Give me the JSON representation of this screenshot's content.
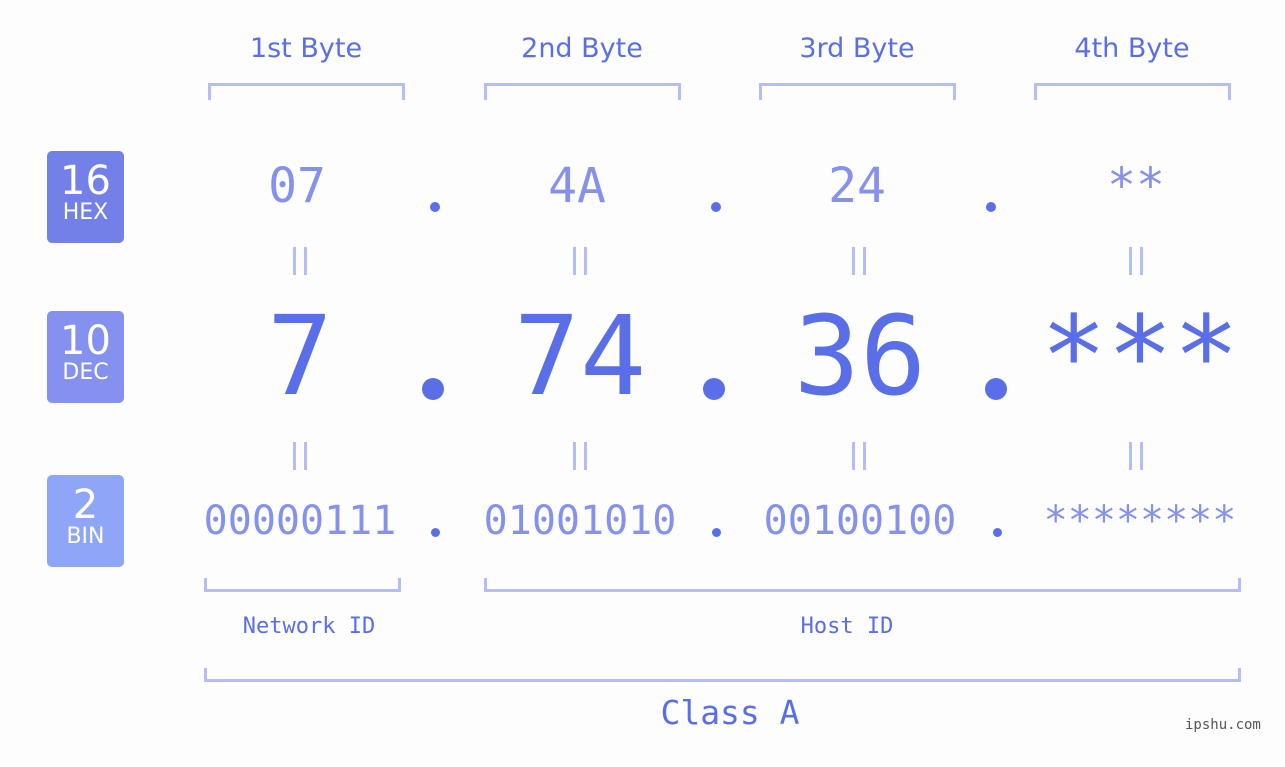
{
  "badges": [
    {
      "number": "16",
      "label": "HEX",
      "color": "#7280e8"
    },
    {
      "number": "10",
      "label": "DEC",
      "color": "#8591ee"
    },
    {
      "number": "2",
      "label": "BIN",
      "color": "#8fa6f8"
    }
  ],
  "byte_headers": [
    "1st Byte",
    "2nd Byte",
    "3rd Byte",
    "4th Byte"
  ],
  "hex": [
    "07",
    "4A",
    "24",
    "**"
  ],
  "dec": [
    "7",
    "74",
    "36",
    "***"
  ],
  "bin": [
    "00000111",
    "01001010",
    "00100100",
    "********"
  ],
  "separator": ".",
  "network_label": "Network ID",
  "host_label": "Host ID",
  "class_label": "Class A",
  "watermark": "ipshu.com",
  "colors": {
    "primary": "#5a6ee8",
    "secondary": "#8592ec",
    "bracket": "#b4bdf6"
  }
}
